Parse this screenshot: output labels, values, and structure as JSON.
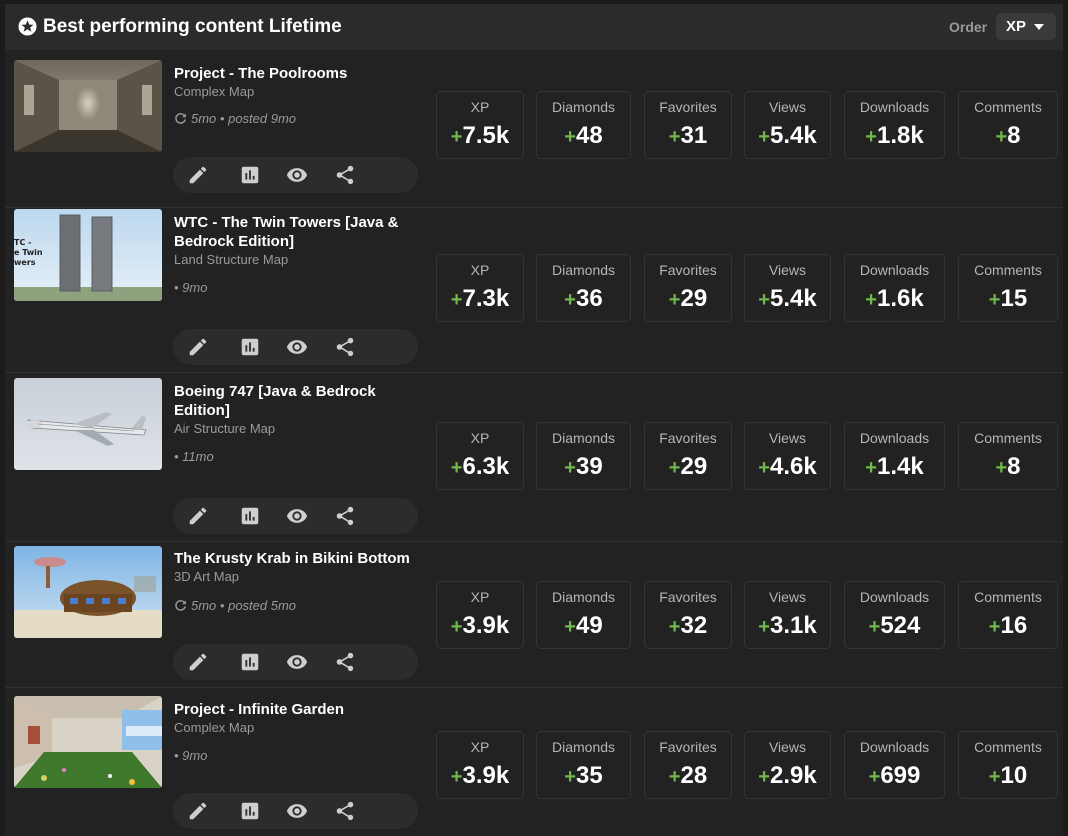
{
  "header": {
    "title": "Best performing content Lifetime",
    "order_label": "Order",
    "order_value": "XP"
  },
  "colors": {
    "positive": "#6fba4a",
    "panel": "#222222",
    "header": "#2b2b2b"
  },
  "stat_labels": [
    "XP",
    "Diamonds",
    "Favorites",
    "Views",
    "Downloads",
    "Comments"
  ],
  "items": [
    {
      "title": "Project - The Poolrooms",
      "category": "Complex Map",
      "updated": "5mo",
      "posted": "• posted 9mo",
      "stats": [
        {
          "sign": "+",
          "value": "7.5k"
        },
        {
          "sign": "+",
          "value": "48"
        },
        {
          "sign": "+",
          "value": "31"
        },
        {
          "sign": "+",
          "value": "5.4k"
        },
        {
          "sign": "+",
          "value": "1.8k"
        },
        {
          "sign": "+",
          "value": "8"
        }
      ]
    },
    {
      "title": "WTC - The Twin Towers [Java & Bedrock Edition]",
      "category": "Land Structure Map",
      "updated": "",
      "posted": "• 9mo",
      "stats": [
        {
          "sign": "+",
          "value": "7.3k"
        },
        {
          "sign": "+",
          "value": "36"
        },
        {
          "sign": "+",
          "value": "29"
        },
        {
          "sign": "+",
          "value": "5.4k"
        },
        {
          "sign": "+",
          "value": "1.6k"
        },
        {
          "sign": "+",
          "value": "15"
        }
      ]
    },
    {
      "title": "Boeing 747 [Java & Bedrock Edition]",
      "category": "Air Structure Map",
      "updated": "",
      "posted": "• 11mo",
      "stats": [
        {
          "sign": "+",
          "value": "6.3k"
        },
        {
          "sign": "+",
          "value": "39"
        },
        {
          "sign": "+",
          "value": "29"
        },
        {
          "sign": "+",
          "value": "4.6k"
        },
        {
          "sign": "+",
          "value": "1.4k"
        },
        {
          "sign": "+",
          "value": "8"
        }
      ]
    },
    {
      "title": "The Krusty Krab in Bikini Bottom",
      "category": "3D Art Map",
      "updated": "5mo",
      "posted": "• posted 5mo",
      "stats": [
        {
          "sign": "+",
          "value": "3.9k"
        },
        {
          "sign": "+",
          "value": "49"
        },
        {
          "sign": "+",
          "value": "32"
        },
        {
          "sign": "+",
          "value": "3.1k"
        },
        {
          "sign": "+",
          "value": "524"
        },
        {
          "sign": "+",
          "value": "16"
        }
      ]
    },
    {
      "title": "Project - Infinite Garden",
      "category": "Complex Map",
      "updated": "",
      "posted": "• 9mo",
      "stats": [
        {
          "sign": "+",
          "value": "3.9k"
        },
        {
          "sign": "+",
          "value": "35"
        },
        {
          "sign": "+",
          "value": "28"
        },
        {
          "sign": "+",
          "value": "2.9k"
        },
        {
          "sign": "+",
          "value": "699"
        },
        {
          "sign": "+",
          "value": "10"
        }
      ]
    }
  ],
  "icons": [
    "star-icon",
    "caret-down-icon",
    "refresh-icon",
    "edit-icon",
    "stats-icon",
    "view-icon",
    "share-icon"
  ]
}
